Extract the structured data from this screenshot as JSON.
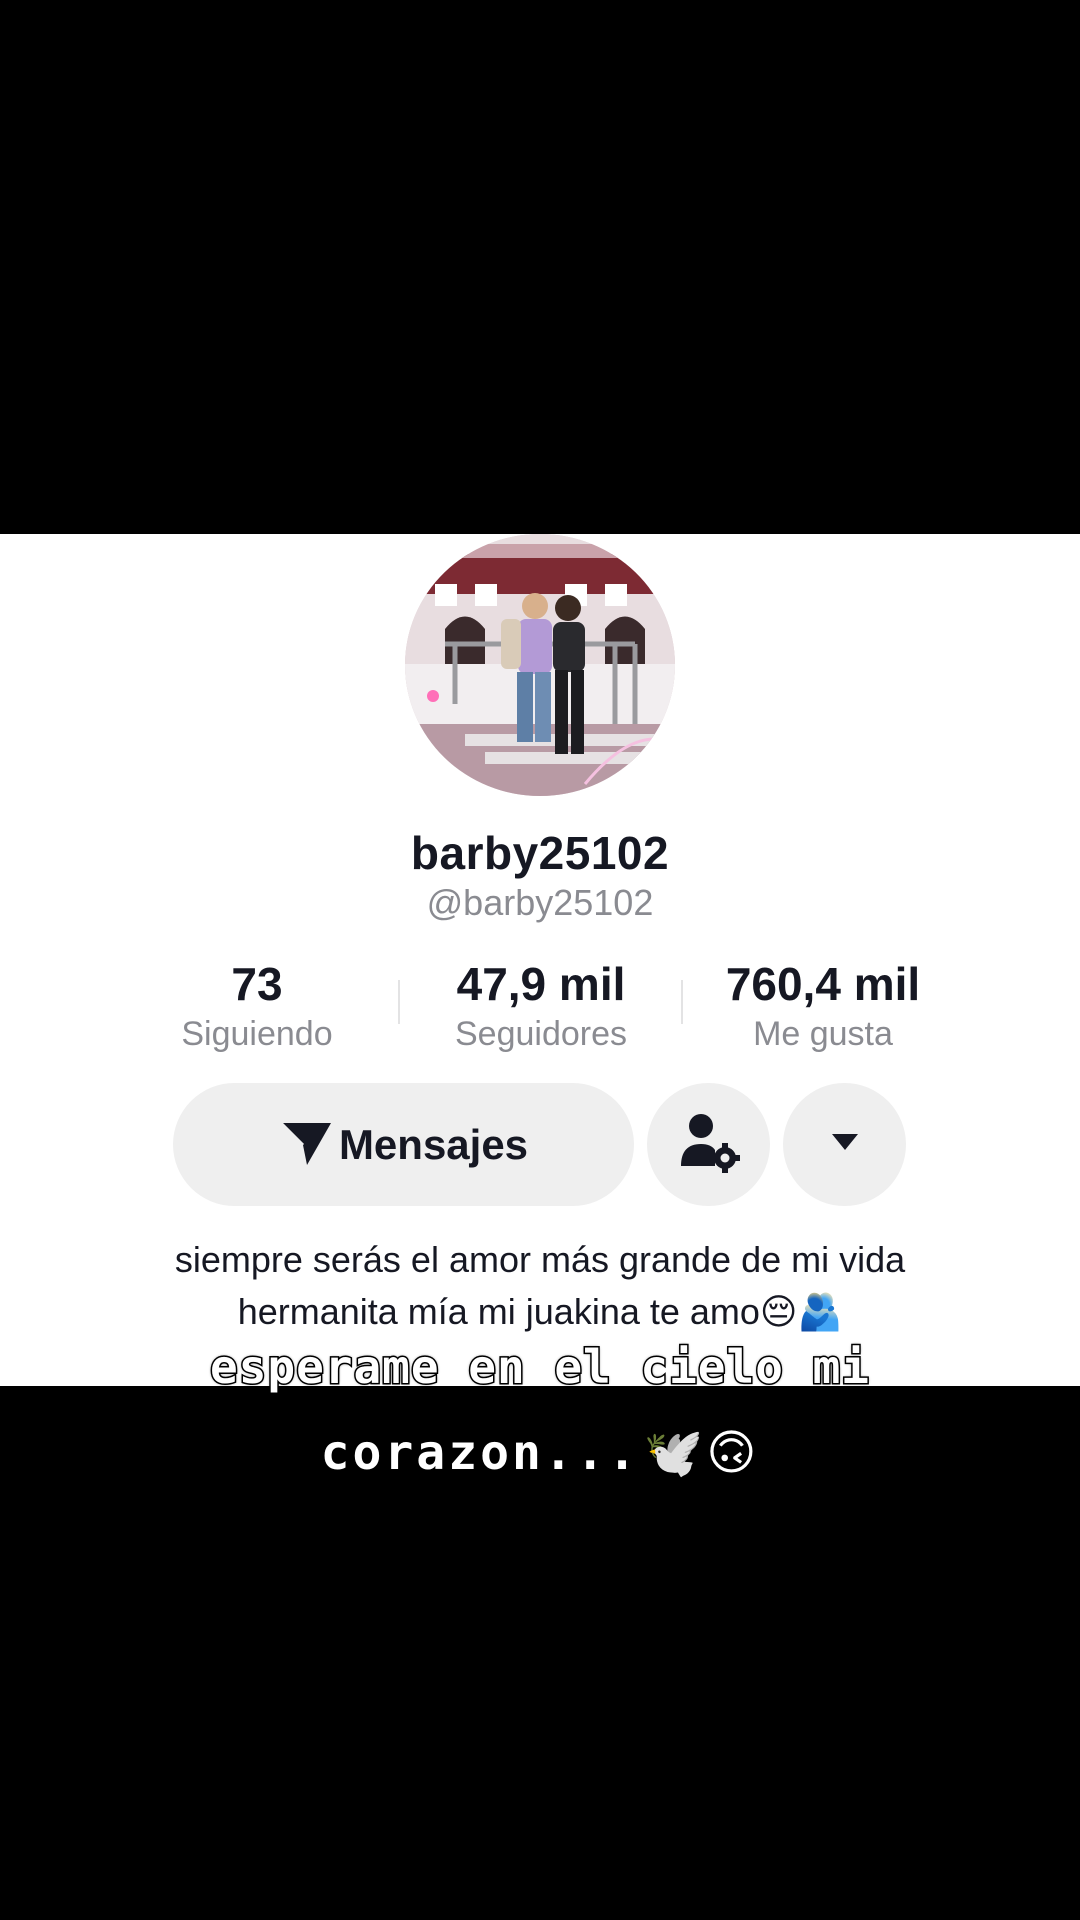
{
  "profile": {
    "display_name": "barby25102",
    "handle": "@barby25102"
  },
  "stats": [
    {
      "value": "73",
      "label": "Siguiendo"
    },
    {
      "value": "47,9 mil",
      "label": "Seguidores"
    },
    {
      "value": "760,4 mil",
      "label": "Me gusta"
    }
  ],
  "actions": {
    "messages_label": "Mensajes"
  },
  "bio": {
    "line1": "siempre serás el amor más grande de mi vida",
    "line2": "hermanita mía mi juakina te amo😔🫂"
  },
  "overlay": {
    "line1": "esperame en el cielo mi",
    "line2_text": "corazon...",
    "line2_emojis": "🕊️🙃"
  },
  "icons": {
    "send": "send-icon",
    "person_settings": "person-settings-icon",
    "dropdown": "caret-down-icon"
  },
  "colors": {
    "background": "#000000",
    "panel": "#ffffff",
    "button_bg": "#efefef",
    "primary_text": "#161823",
    "secondary_text": "#8a8b91"
  }
}
